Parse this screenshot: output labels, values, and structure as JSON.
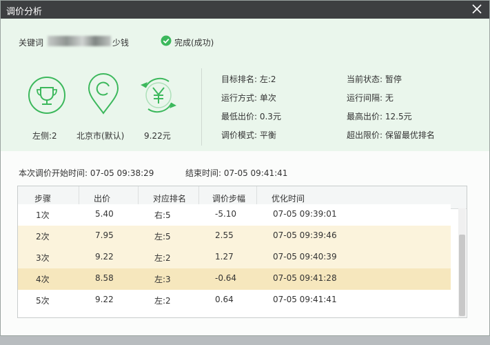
{
  "window": {
    "title": "调价分析"
  },
  "keyword": {
    "label": "关键词",
    "suffix": "少钱"
  },
  "status": {
    "text": "完成(成功)"
  },
  "icons": [
    {
      "name": "trophy-icon",
      "label": "左侧:2"
    },
    {
      "name": "location-pin-icon",
      "label": "北京市(默认)"
    },
    {
      "name": "yuan-cycle-icon",
      "label": "9.22元"
    }
  ],
  "info": {
    "left": [
      "目标排名: 左:2",
      "运行方式: 单次",
      "最低出价: 0.3元",
      "调价模式: 平衡"
    ],
    "right": [
      "当前状态: 暂停",
      "运行间隔: 无",
      "最高出价: 12.5元",
      "超出限价: 保留最优排名"
    ]
  },
  "times": {
    "start": "本次调价开始时间: 07-05 09:38:29",
    "end": "结束时间: 07-05 09:41:41"
  },
  "table": {
    "headers": [
      "步骤",
      "出价",
      "对应排名",
      "调价步幅",
      "优化时间"
    ],
    "rows": [
      [
        "1次",
        "5.40",
        "右:5",
        "-5.10",
        "07-05 09:39:01"
      ],
      [
        "2次",
        "7.95",
        "左:5",
        "2.55",
        "07-05 09:39:46"
      ],
      [
        "3次",
        "9.22",
        "左:2",
        "1.27",
        "07-05 09:40:39"
      ],
      [
        "4次",
        "8.58",
        "左:3",
        "-0.64",
        "07-05 09:41:28"
      ],
      [
        "5次",
        "9.22",
        "左:2",
        "0.64",
        "07-05 09:41:41"
      ]
    ],
    "row_colors": [
      "#ffffff",
      "#fbf3dc",
      "#fbf3dc",
      "#f6e7bd",
      "#ffffff"
    ]
  },
  "colors": {
    "titlebar": "#3d3f41",
    "accent_green": "#3cb85c",
    "panel_bg": "#eaf6ec"
  }
}
